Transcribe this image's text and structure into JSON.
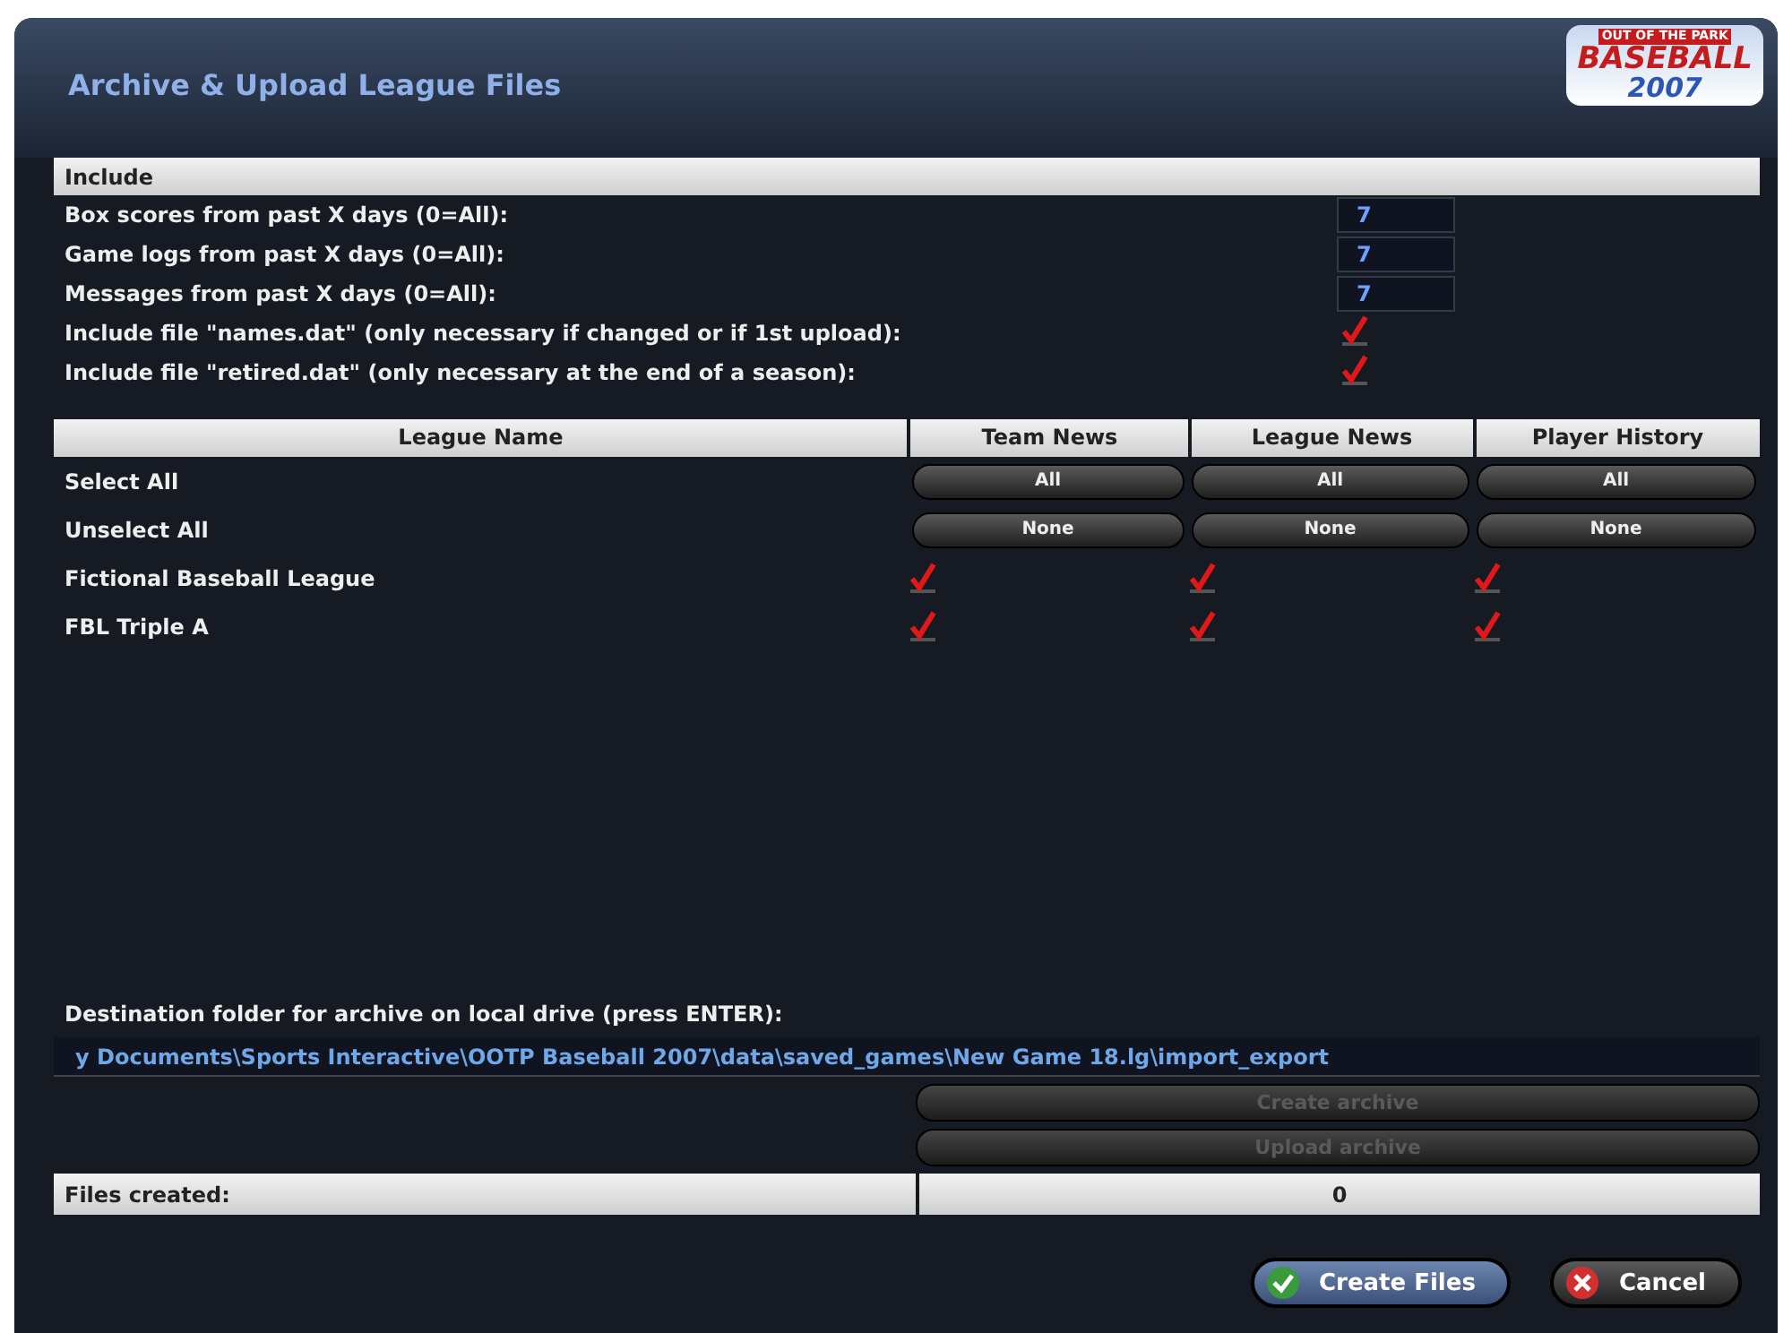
{
  "window": {
    "title": "Archive & Upload League Files"
  },
  "logo": {
    "line_1": "OUT OF THE PARK",
    "line_2": "BASEBALL",
    "line_3": "2007"
  },
  "include": {
    "heading": "Include",
    "settings": [
      {
        "kind": "number",
        "label": "Box scores from past X days (0=All):",
        "value": "7"
      },
      {
        "kind": "number",
        "label": "Game logs from past X days (0=All):",
        "value": "7"
      },
      {
        "kind": "number",
        "label": "Messages from past X days (0=All):",
        "value": "7"
      },
      {
        "kind": "checkbox",
        "label": "Include file \"names.dat\" (only necessary if changed or if 1st upload):",
        "checked": true
      },
      {
        "kind": "checkbox",
        "label": "Include file \"retired.dat\" (only necessary at the end of a season):",
        "checked": true
      }
    ]
  },
  "table": {
    "columns": [
      "League Name",
      "Team News",
      "League News",
      "Player History"
    ],
    "rows": [
      {
        "kind": "buttons",
        "label": "Select All",
        "buttons": [
          "All",
          "All",
          "All"
        ]
      },
      {
        "kind": "buttons",
        "label": "Unselect All",
        "buttons": [
          "None",
          "None",
          "None"
        ]
      },
      {
        "kind": "checks",
        "label": "Fictional Baseball League",
        "checks": [
          true,
          true,
          true
        ]
      },
      {
        "kind": "checks",
        "label": "FBL Triple A",
        "checks": [
          true,
          true,
          true
        ]
      }
    ]
  },
  "destination": {
    "label": "Destination folder for archive on local drive (press ENTER):",
    "value": "y Documents\\Sports Interactive\\OOTP Baseball 2007\\data\\saved_games\\New Game 18.lg\\import_export"
  },
  "archive_buttons": [
    {
      "label": "Create archive",
      "disabled": true
    },
    {
      "label": "Upload archive",
      "disabled": true
    }
  ],
  "files_created": {
    "label": "Files created:",
    "value": "0"
  },
  "buttons": [
    {
      "kind": "ok",
      "label": "Create Files"
    },
    {
      "kind": "cancel",
      "label": "Cancel"
    }
  ]
}
